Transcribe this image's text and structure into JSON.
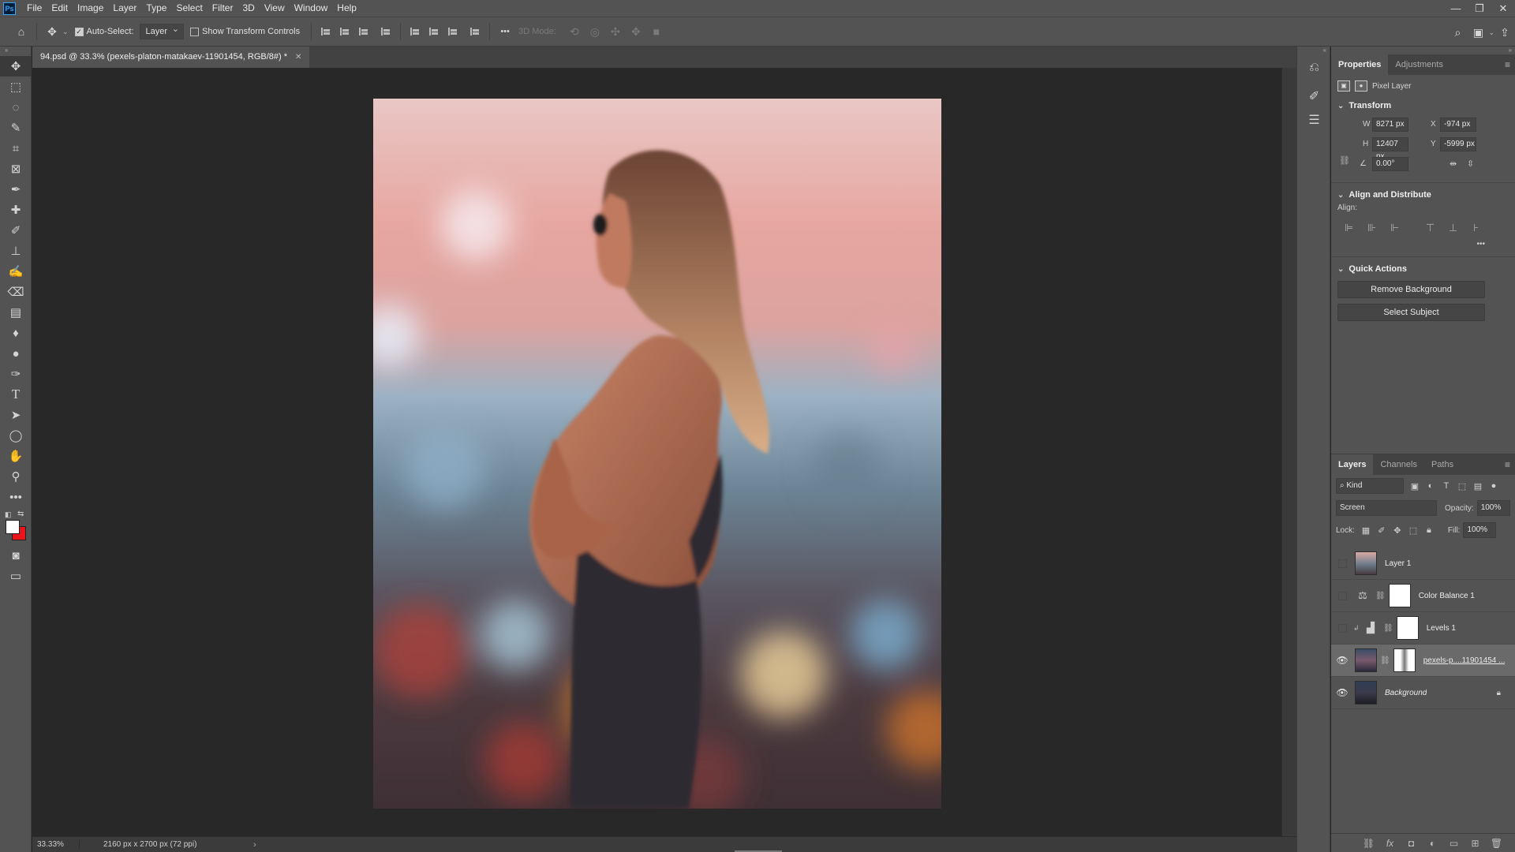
{
  "app": {
    "logo": "Ps",
    "menu": [
      "File",
      "Edit",
      "Image",
      "Layer",
      "Type",
      "Select",
      "Filter",
      "3D",
      "View",
      "Window",
      "Help"
    ],
    "window_controls": [
      "—",
      "❐",
      "✕"
    ]
  },
  "options_bar": {
    "auto_select_label": "Auto-Select:",
    "auto_select_checked": true,
    "auto_select_target": "Layer",
    "show_transform_label": "Show Transform Controls",
    "show_transform_checked": false,
    "more_label": "•••",
    "mode_3d_label": "3D Mode:"
  },
  "document": {
    "tab_title": "94.psd @ 33.3% (pexels-platon-matakaev-11901454, RGB/8#) *",
    "zoom": "33.33%",
    "size": "2160 px x 2700 px (72 ppi)"
  },
  "properties": {
    "tabs": [
      "Properties",
      "Adjustments"
    ],
    "layer_kind": "Pixel Layer",
    "transform": {
      "title": "Transform",
      "w_label": "W",
      "w": "8271 px",
      "h_label": "H",
      "h": "12407 px",
      "x_label": "X",
      "x": "-974 px",
      "y_label": "Y",
      "y": "-5999 px",
      "angle": "0.00°"
    },
    "align": {
      "title": "Align and Distribute",
      "label": "Align:",
      "more": "•••"
    },
    "quick_actions": {
      "title": "Quick Actions",
      "buttons": [
        "Remove Background",
        "Select Subject"
      ]
    }
  },
  "layers_panel": {
    "tabs": [
      "Layers",
      "Channels",
      "Paths"
    ],
    "filter_kind": "Kind",
    "blend_mode": "Screen",
    "opacity_label": "Opacity:",
    "opacity": "100%",
    "lock_label": "Lock:",
    "fill_label": "Fill:",
    "fill": "100%",
    "layers": [
      {
        "name": "Layer 1",
        "visible": false
      },
      {
        "name": "Color Balance 1",
        "visible": false
      },
      {
        "name": "Levels 1",
        "visible": false
      },
      {
        "name": "pexels-p....11901454 ...",
        "visible": true,
        "selected": true
      },
      {
        "name": "Background",
        "visible": true,
        "locked": true
      }
    ]
  }
}
